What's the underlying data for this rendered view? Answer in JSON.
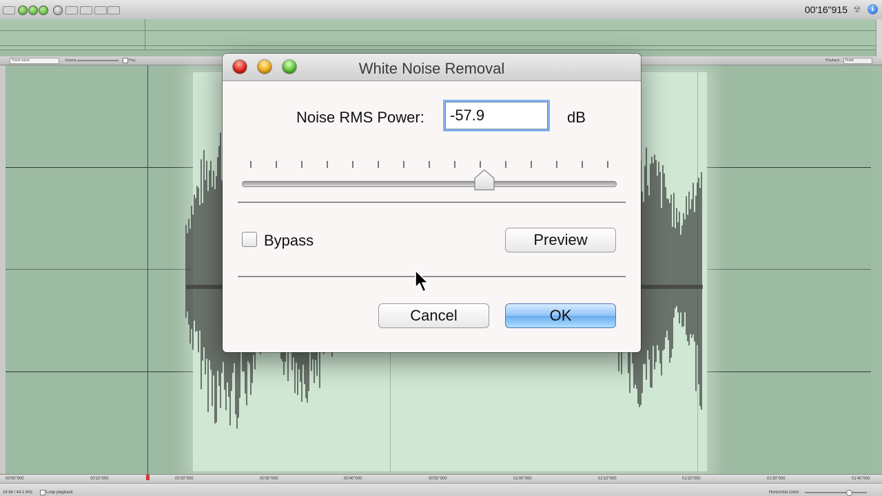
{
  "toolbar": {
    "timecode": "00'16\"915"
  },
  "track_header": {
    "track_name_placeholder": "Track name",
    "volume_label": "Volume",
    "play_label": "Play",
    "playback_label": "Playback",
    "playback_value": "Front"
  },
  "ruler": {
    "ticks": [
      "00'00\"000",
      "00'10\"000",
      "00'20\"000",
      "00'30\"000",
      "00'40\"000",
      "00'50\"000",
      "01'00\"000",
      "01'10\"000",
      "01'20\"000",
      "01'30\"000",
      "01'40\"000"
    ]
  },
  "statusbar": {
    "format": "16 bit / 44.1 kHz",
    "loop_label": "Loop playback",
    "zoom_label": "Horizontal zoom"
  },
  "dialog": {
    "title": "White Noise Removal",
    "noise_label": "Noise RMS Power:",
    "noise_value": "-57.9",
    "unit": "dB",
    "slider_value_fraction": 0.65,
    "bypass_label": "Bypass",
    "bypass_checked": false,
    "preview_label": "Preview",
    "cancel_label": "Cancel",
    "ok_label": "OK"
  },
  "colors": {
    "waveform_bg": "#9dbaa2",
    "selection_bg": "#cfe7d3",
    "playhead": "#2a3fc8",
    "ok_accent": "#6aaaf0"
  },
  "icons": {
    "close": "close-icon",
    "minimize": "minimize-icon",
    "zoom": "zoom-icon",
    "info": "info-icon",
    "cursor": "cursor-arrow-icon"
  }
}
